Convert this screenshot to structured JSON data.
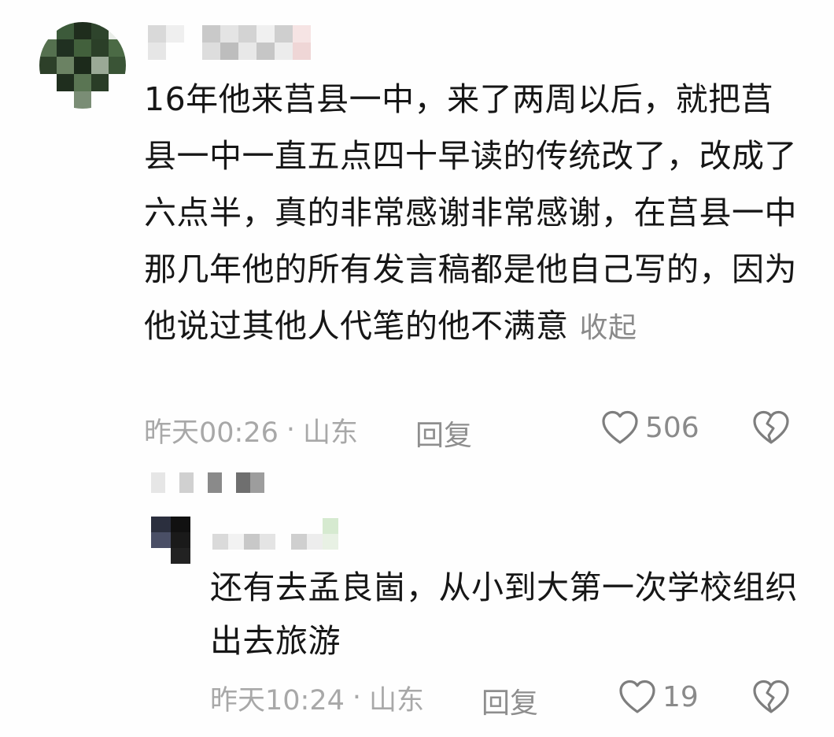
{
  "comment": {
    "text": "16年他来莒县一中，来了两周以后，就把莒县一中一直五点四十早读的传统改了，改成了六点半，真的非常感谢非常感谢，在莒县一中那几年他的所有发言稿都是他自己写的，因为他说过其他人代笔的他不满意",
    "collapse_label": "收起",
    "time": "昨天00:26",
    "separator": "·",
    "location": "山东",
    "reply_label": "回复",
    "like_count": "506"
  },
  "reply": {
    "text": "还有去孟良崮，从小到大第一次学校组织出去旅游",
    "time": "昨天10:24",
    "separator": "·",
    "location": "山东",
    "reply_label": "回复",
    "like_count": "19"
  },
  "icons": {
    "like": "heart-outline-icon",
    "dislike": "broken-heart-outline-icon"
  },
  "colors": {
    "text": "#161616",
    "meta": "#a8a8a8",
    "icon": "#7e7e7e"
  }
}
